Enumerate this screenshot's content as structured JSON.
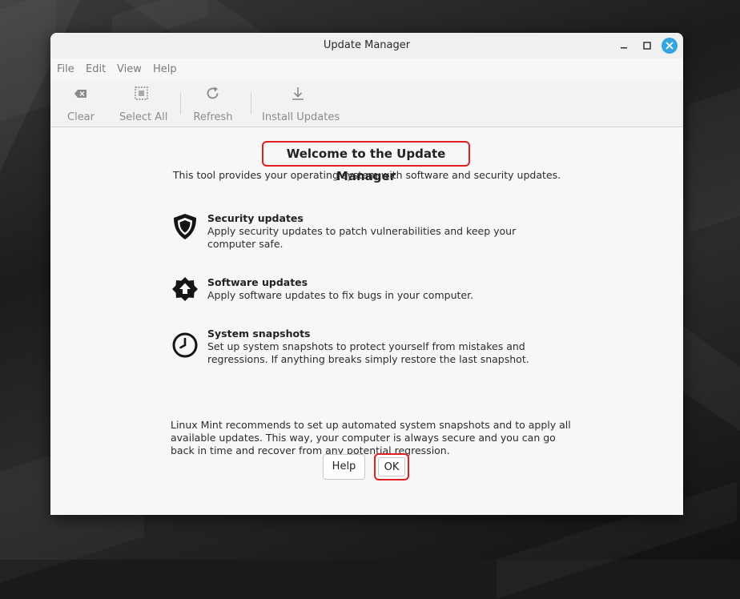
{
  "window": {
    "title": "Update Manager"
  },
  "menu": {
    "file": "File",
    "edit": "Edit",
    "view": "View",
    "help": "Help"
  },
  "toolbar": {
    "clear": {
      "label": "Clear",
      "icon": "backspace-icon"
    },
    "select_all": {
      "label": "Select All",
      "icon": "select-all-icon"
    },
    "refresh": {
      "label": "Refresh",
      "icon": "refresh-icon"
    },
    "install": {
      "label": "Install Updates",
      "icon": "download-icon"
    }
  },
  "welcome": {
    "heading": "Welcome to the Update Manager",
    "subtitle": "This tool provides your operating system with software and security updates."
  },
  "features": [
    {
      "title": "Security updates",
      "description": "Apply security updates to patch vulnerabilities and keep your computer safe.",
      "icon": "shield-icon"
    },
    {
      "title": "Software updates",
      "description": "Apply software updates to fix bugs in your computer.",
      "icon": "badge-upload-icon"
    },
    {
      "title": "System snapshots",
      "description": "Set up system snapshots to protect yourself from mistakes and regressions. If anything breaks simply restore the last snapshot.",
      "icon": "clock-icon"
    }
  ],
  "recommendation": "Linux Mint recommends to set up automated system snapshots and to apply all available updates. This way, your computer is always secure and you can go back in time and recover from any potential regression.",
  "buttons": {
    "help": "Help",
    "ok": "OK"
  },
  "colors": {
    "accent_close": "#35a5e0",
    "highlight": "#e02020"
  }
}
